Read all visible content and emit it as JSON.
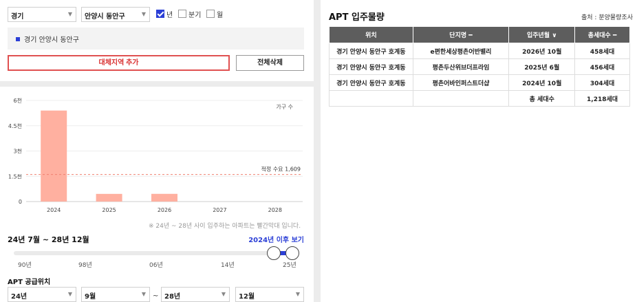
{
  "filters": {
    "province": "경기",
    "city": "안양시 동안구",
    "period_options": [
      {
        "label": "년",
        "checked": true
      },
      {
        "label": "분기",
        "checked": false
      },
      {
        "label": "월",
        "checked": false
      }
    ]
  },
  "region_chip": "경기 안양시 동안구",
  "buttons": {
    "add_region": "대체지역 추가",
    "delete_all": "전체삭제"
  },
  "chart_data": {
    "type": "bar",
    "categories": [
      "2024",
      "2025",
      "2026",
      "2027",
      "2028"
    ],
    "values": [
      5400,
      456,
      458,
      0,
      0
    ],
    "y_ticks": [
      "0",
      "1.5천",
      "3천",
      "4.5천",
      "6천"
    ],
    "ylim": [
      0,
      6000
    ],
    "legend": "가구 수",
    "reference_line": {
      "label": "적정 수요 1,609",
      "value": 1609
    },
    "bar_color": "#ffb0a0",
    "grid": true
  },
  "chart_note": "※ 24년 ~ 28년 사이 입주하는 아파트는 빨간막대 입니다.",
  "period_label": "24년 7월 ~ 28년 12월",
  "after_link": "2024년 이후 보기",
  "slider": {
    "ticks": [
      "90년",
      "98년",
      "06년",
      "14년",
      "25년"
    ],
    "range": [
      0.93,
      0.98
    ]
  },
  "supply_title": "APT 공급위치",
  "supply_selects": [
    "24년",
    "9월",
    "28년",
    "12월"
  ],
  "tilde": "~",
  "apt": {
    "title": "APT 입주물량",
    "source": "출처 : 분양물량조사",
    "headers": [
      "위치",
      "단지명 ━",
      "입주년월 ∨",
      "총세대수 ━"
    ],
    "rows": [
      [
        "경기 안양시 동안구 호계동",
        "e편한세상평촌어반밸리",
        "2026년 10월",
        "458세대"
      ],
      [
        "경기 안양시 동안구 호계동",
        "평촌두산위브더프라임",
        "2025년 6월",
        "456세대"
      ],
      [
        "경기 안양시 동안구 호계동",
        "평촌어바인퍼스트더샵",
        "2024년 10월",
        "304세대"
      ]
    ],
    "total_label": "총 세대수",
    "total_value": "1,218세대"
  },
  "colors": {
    "accent": "#2b3fd6",
    "danger": "#d93030",
    "table_header": "#5d5d5d"
  }
}
